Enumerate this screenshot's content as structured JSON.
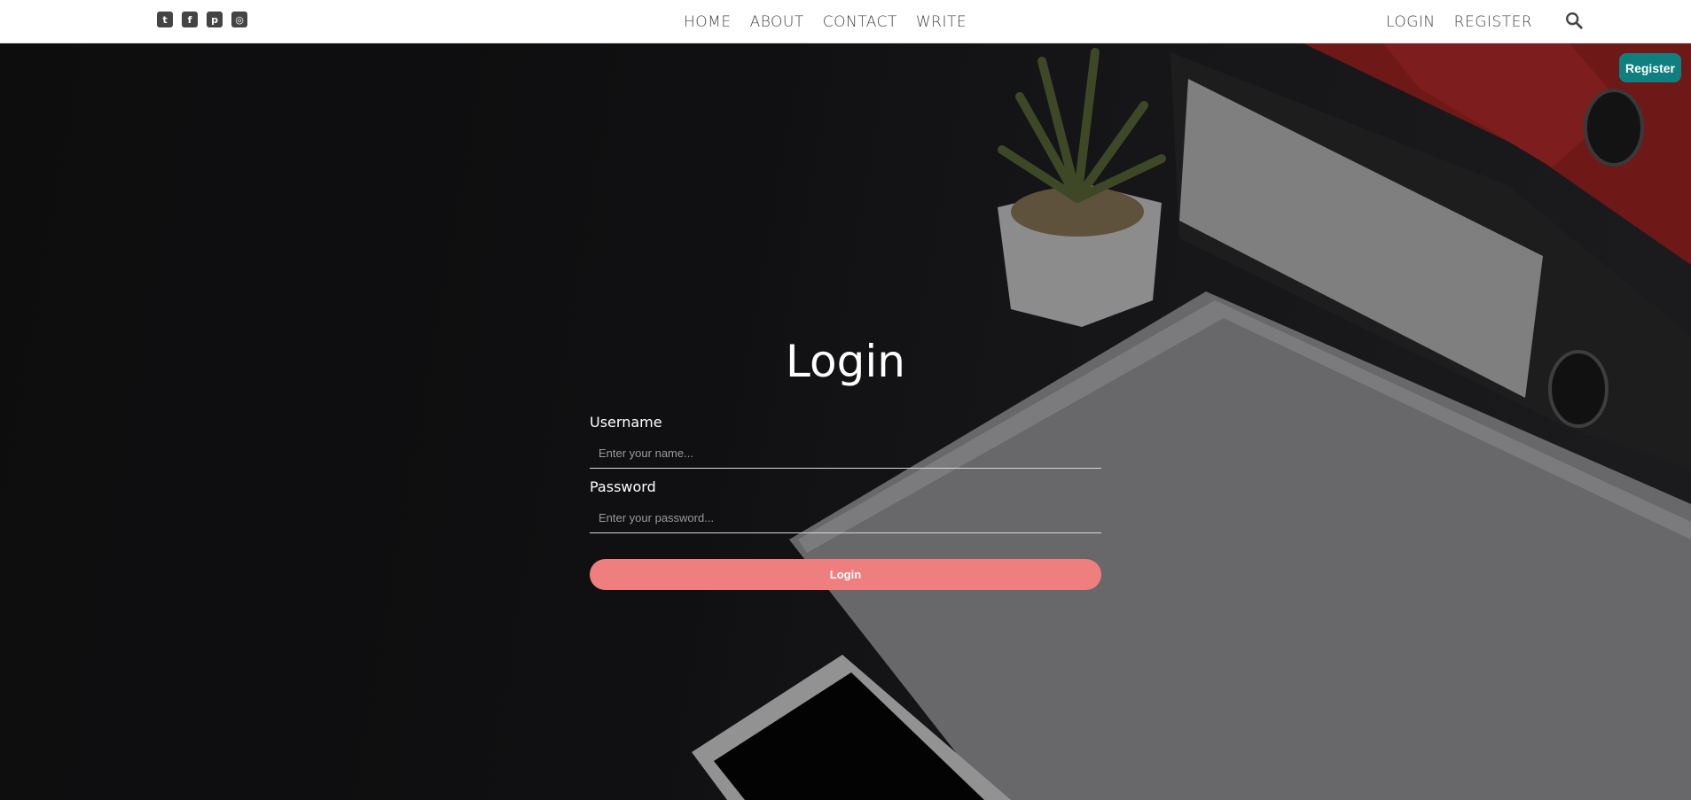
{
  "social": [
    {
      "icon": "twitter-icon",
      "glyph": "t"
    },
    {
      "icon": "facebook-icon",
      "glyph": "f"
    },
    {
      "icon": "pinterest-icon",
      "glyph": "p"
    },
    {
      "icon": "instagram-icon",
      "glyph": "◎"
    }
  ],
  "nav": {
    "home": "HOME",
    "about": "ABOUT",
    "contact": "CONTACT",
    "write": "WRITE",
    "login": "LOGIN",
    "register": "REGISTER"
  },
  "register_button": "Register",
  "login_form": {
    "title": "Login",
    "username_label": "Username",
    "username_placeholder": "Enter your name...",
    "password_label": "Password",
    "password_placeholder": "Enter your password...",
    "submit_label": "Login"
  },
  "colors": {
    "register_button": "#0f7f80",
    "login_button": "#ef7e7e",
    "nav_text": "#444444"
  }
}
